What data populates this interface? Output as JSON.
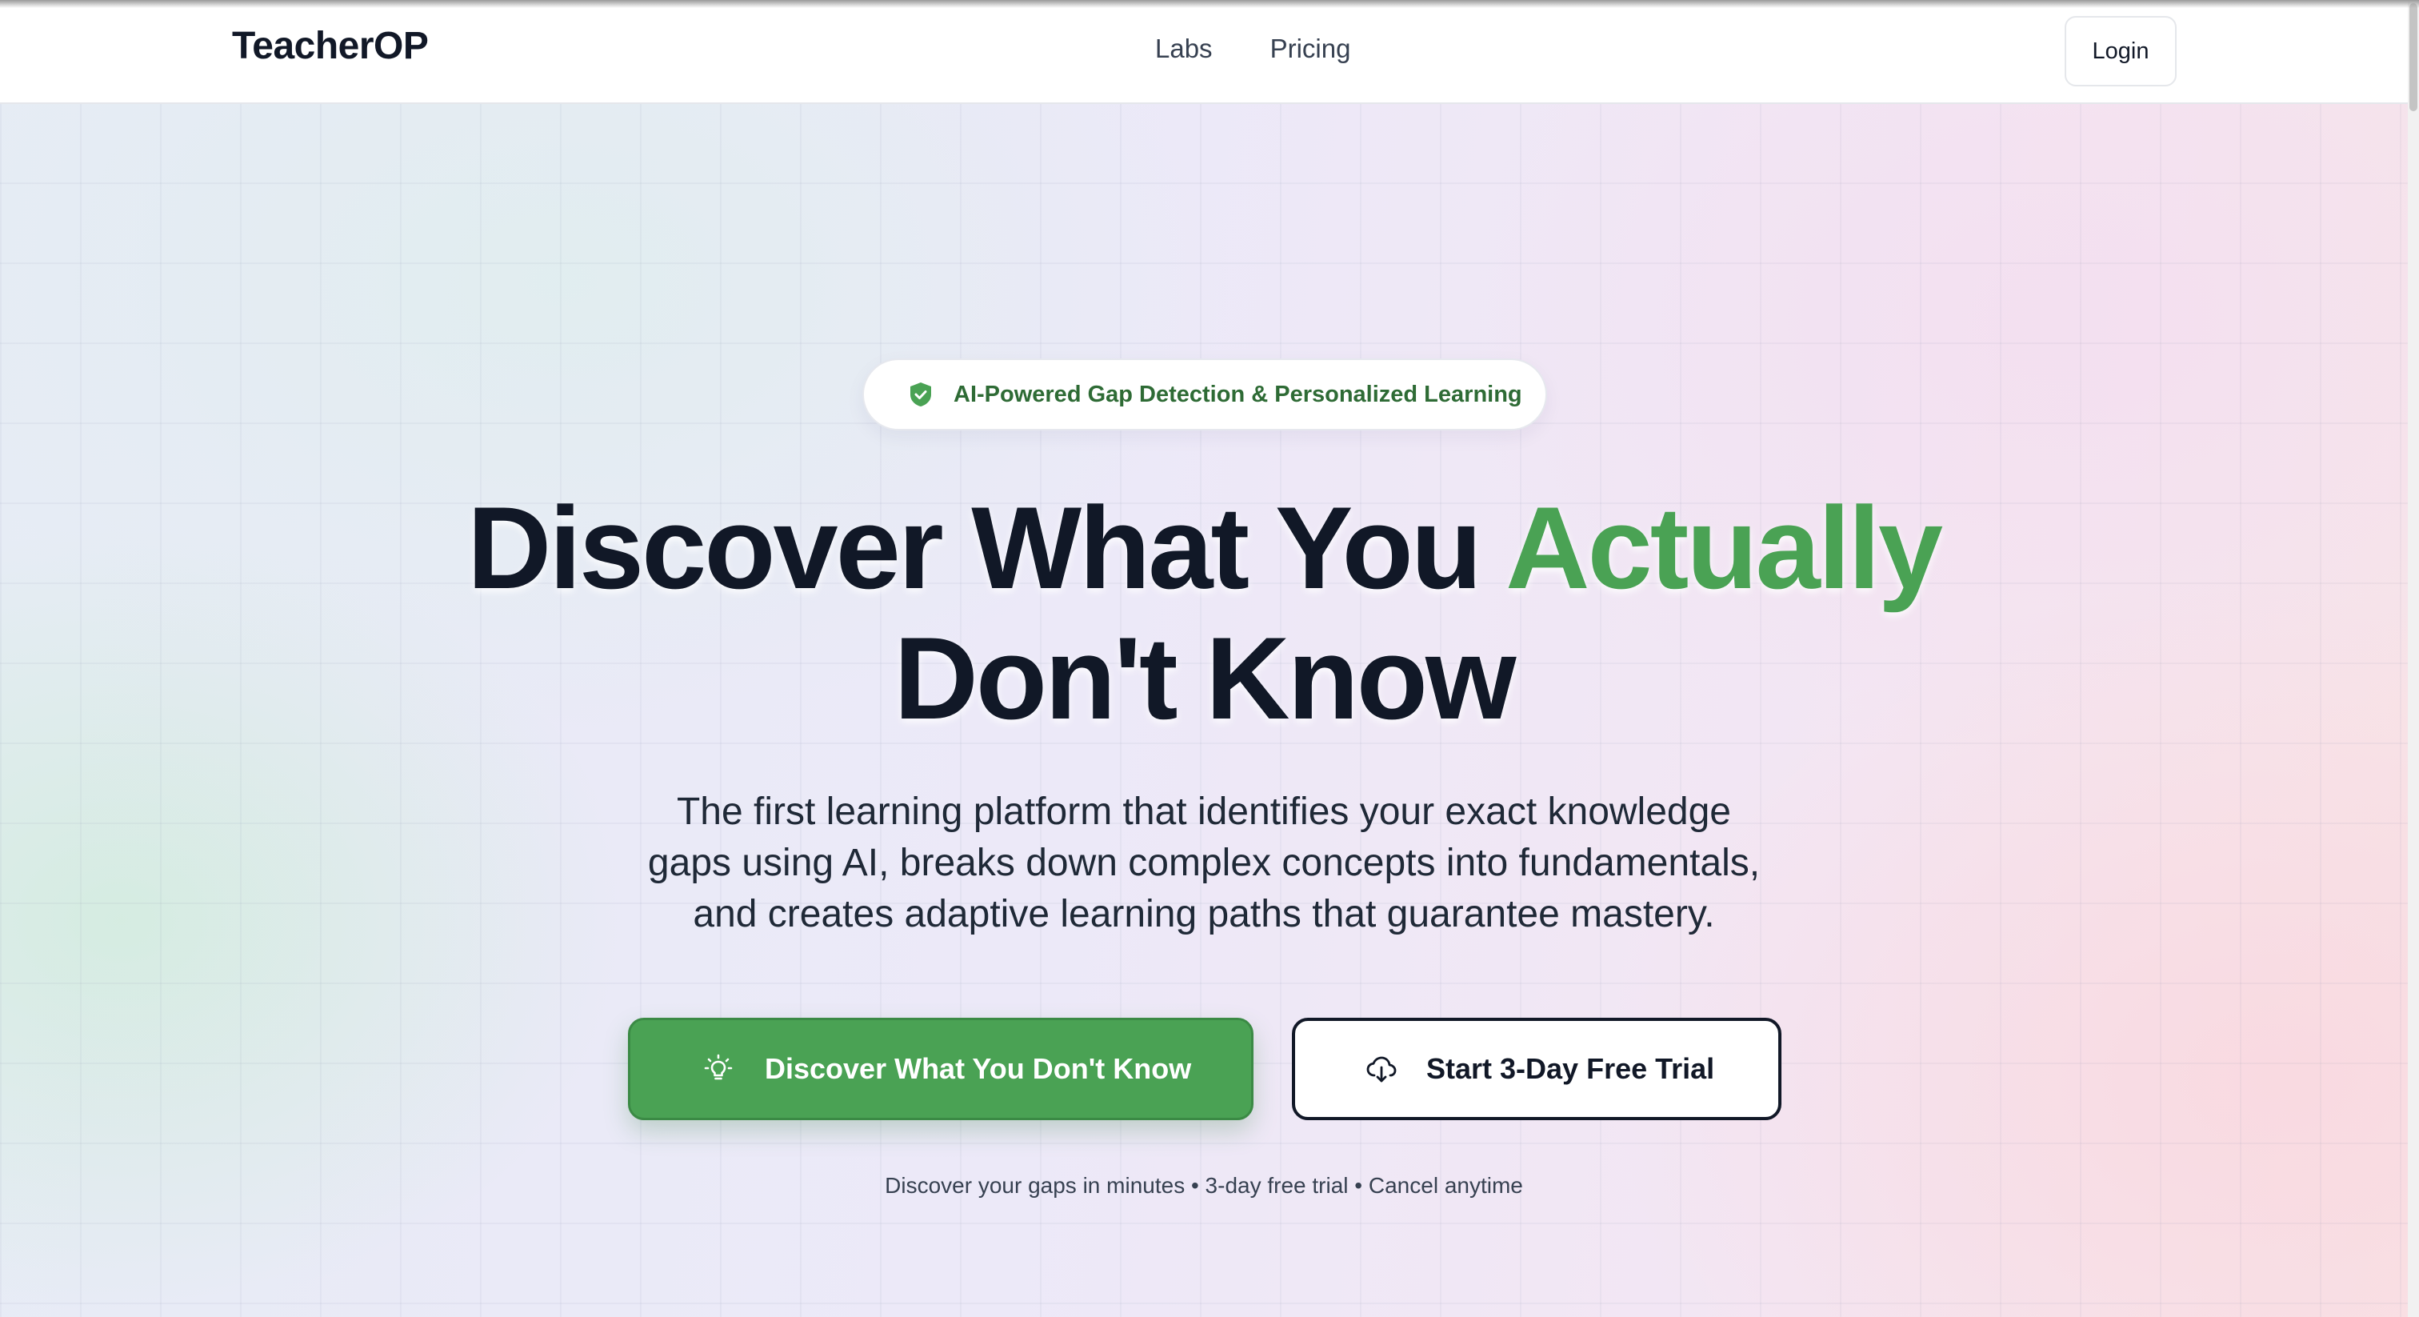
{
  "header": {
    "logo": "TeacherOP",
    "nav": [
      {
        "label": "Labs"
      },
      {
        "label": "Pricing"
      }
    ],
    "login_label": "Login"
  },
  "hero": {
    "badge": {
      "icon": "shield-check-icon",
      "text": "AI-Powered Gap Detection & Personalized Learning"
    },
    "headline": {
      "line1_main": "Discover What You ",
      "line1_accent": "Actually",
      "line2": "Don't Know"
    },
    "subtext": [
      "The first learning platform that identifies your exact knowledge",
      "gaps using AI, breaks down complex concepts into fundamentals,",
      "and creates adaptive learning paths that guarantee mastery."
    ],
    "primary_cta": {
      "icon": "lightbulb-icon",
      "label": "Discover What You Don't Know"
    },
    "secondary_cta": {
      "icon": "cloud-download-icon",
      "label": "Start 3-Day Free Trial"
    },
    "fineprint": "Discover your gaps in minutes • 3-day free trial • Cancel anytime"
  },
  "colors": {
    "accent": "#4aa254",
    "text": "#111827",
    "badge_text": "#2e6b35"
  }
}
